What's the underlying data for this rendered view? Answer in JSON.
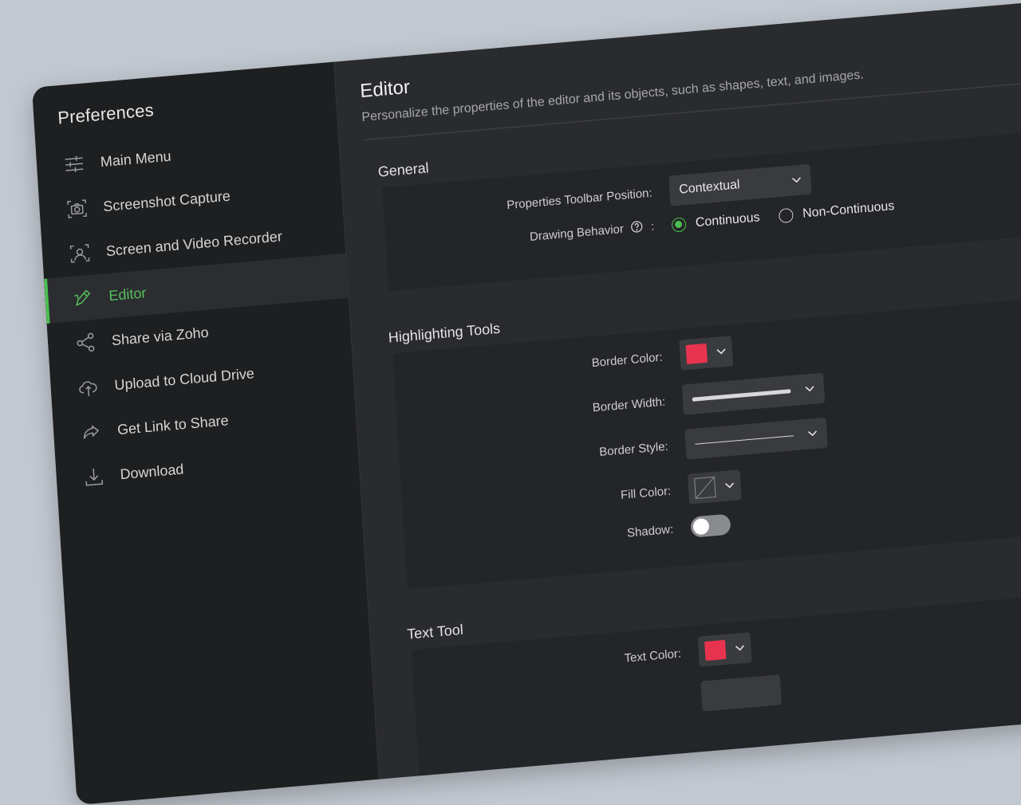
{
  "sidebar": {
    "title": "Preferences",
    "items": [
      {
        "label": "Main Menu",
        "icon": "sliders-icon"
      },
      {
        "label": "Screenshot Capture",
        "icon": "camera-icon"
      },
      {
        "label": "Screen and Video Recorder",
        "icon": "user-frame-icon"
      },
      {
        "label": "Editor",
        "icon": "pencil-icon",
        "active": true
      },
      {
        "label": "Share via Zoho",
        "icon": "share-icon"
      },
      {
        "label": "Upload to Cloud Drive",
        "icon": "cloud-upload-icon"
      },
      {
        "label": "Get Link to Share",
        "icon": "forward-arrow-icon"
      },
      {
        "label": "Download",
        "icon": "download-icon"
      }
    ]
  },
  "main": {
    "title": "Editor",
    "description": "Personalize the properties of the editor and its objects, such as shapes, text, and images.",
    "general": {
      "heading": "General",
      "toolbar_position_label": "Properties Toolbar Position:",
      "toolbar_position_value": "Contextual",
      "drawing_behavior_label": "Drawing Behavior",
      "drawing_behavior_colon": ":",
      "option_continuous": "Continuous",
      "option_non_continuous": "Non-Continuous",
      "selected_option": "Continuous"
    },
    "highlighting": {
      "heading": "Highlighting Tools",
      "border_color_label": "Border Color:",
      "border_width_label": "Border Width:",
      "border_style_label": "Border Style:",
      "fill_color_label": "Fill Color:",
      "shadow_label": "Shadow:",
      "shadow_on": false
    },
    "text_tool": {
      "heading": "Text Tool",
      "text_color_label": "Text Color:"
    }
  },
  "colors": {
    "accent": "#4bbf4f",
    "swatch_red": "#e8334f",
    "sidebar_bg": "#1e1f21",
    "panel_bg": "#242528"
  }
}
